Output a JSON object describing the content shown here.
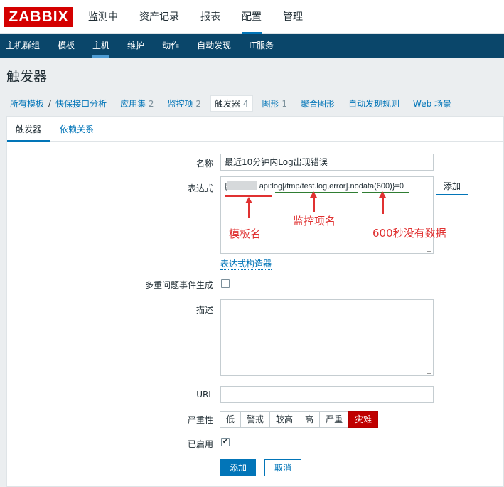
{
  "logo": "ZABBIX",
  "main_menu": [
    "监测中",
    "资产记录",
    "报表",
    "配置",
    "管理"
  ],
  "sub_menu": [
    "主机群组",
    "模板",
    "主机",
    "维护",
    "动作",
    "自动发现",
    "IT服务"
  ],
  "page_title": "触发器",
  "breadcrumb": {
    "all_templates": "所有模板",
    "separator": "/",
    "template": "快保接口分析"
  },
  "object_nav": [
    {
      "label": "应用集",
      "count": "2"
    },
    {
      "label": "监控项",
      "count": "2"
    },
    {
      "label": "触发器",
      "count": "4"
    },
    {
      "label": "图形",
      "count": "1"
    },
    {
      "label": "聚合图形",
      "count": ""
    },
    {
      "label": "自动发现规则",
      "count": ""
    },
    {
      "label": "Web 场景",
      "count": ""
    }
  ],
  "tabs": [
    "触发器",
    "依赖关系"
  ],
  "form": {
    "name_label": "名称",
    "name_value": "最近10分钟内Log出现错误",
    "expr_label": "表达式",
    "expr_prefix": "{",
    "expr_rest": "api:log[/tmp/test.log,error].nodata(600)}=0",
    "expr_add": "添加",
    "expr_builder": "表达式构造器",
    "multi_label": "多重问题事件生成",
    "desc_label": "描述",
    "url_label": "URL",
    "url_value": "",
    "severity_label": "严重性",
    "severity": [
      "低",
      "警戒",
      "较高",
      "高",
      "严重",
      "灾难"
    ],
    "severity_selected": "灾难",
    "enabled_label": "已启用",
    "enabled": true,
    "submit": "添加",
    "cancel": "取消"
  },
  "annotations": {
    "template_name": "模板名",
    "item_name": "监控项名",
    "nodata": "600秒没有数据"
  },
  "colors": {
    "brand_red": "#d40000",
    "nav_dark": "#0a466a",
    "link_blue": "#0275b8",
    "anno_red": "#e03131",
    "green_line": "#2f7d32"
  }
}
